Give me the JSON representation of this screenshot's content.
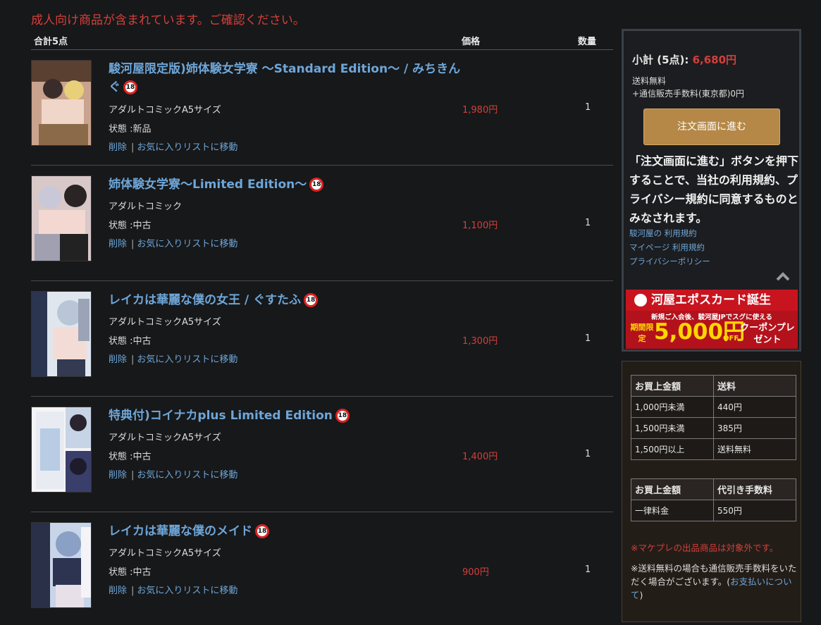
{
  "warning": "成人向け商品が含まれています。ご確認ください。",
  "header": {
    "total": "合計5点",
    "price": "価格",
    "qty": "数量"
  },
  "items": [
    {
      "title": "駿河屋限定版)姉体験女学寮 ～Standard Edition～ / みちきんぐ",
      "category": "アダルトコミックA5サイズ",
      "condition": "状態 :新品",
      "price": "1,980円",
      "qty": "1",
      "delete": "削除",
      "favorite": "お気に入りリストに移動",
      "badge": "18"
    },
    {
      "title": "姉体験女学寮～Limited Edition～",
      "category": "アダルトコミック",
      "condition": "状態 :中古",
      "price": "1,100円",
      "qty": "1",
      "delete": "削除",
      "favorite": "お気に入りリストに移動",
      "badge": "18"
    },
    {
      "title": "レイカは華麗な僕の女王 / ぐすたふ",
      "category": "アダルトコミックA5サイズ",
      "condition": "状態 :中古",
      "price": "1,300円",
      "qty": "1",
      "delete": "削除",
      "favorite": "お気に入りリストに移動",
      "badge": "18"
    },
    {
      "title": "特典付)コイナカplus Limited Edition",
      "category": "アダルトコミックA5サイズ",
      "condition": "状態 :中古",
      "price": "1,400円",
      "qty": "1",
      "delete": "削除",
      "favorite": "お気に入りリストに移動",
      "badge": "18"
    },
    {
      "title": "レイカは華麗な僕のメイド",
      "category": "アダルトコミックA5サイズ",
      "condition": "状態 :中古",
      "price": "900円",
      "qty": "1",
      "delete": "削除",
      "favorite": "お気に入りリストに移動",
      "badge": "18"
    }
  ],
  "summary": {
    "subtotal_label": "小計 (5点):",
    "subtotal_amount": "6,680円",
    "shipping_free": "送料無料",
    "handling_fee": "+通信販売手数料(東京都)0円",
    "order_button": "注文画面に進む",
    "agreement": "「注文画面に進む」ボタンを押下することで、当社の利用規約、プライバシー規約に同意するものとみなされます。",
    "links": [
      "駿河屋の 利用規約",
      "マイページ 利用規約",
      "プライバシーポリシー"
    ]
  },
  "banner": {
    "head": "河屋エポスカード誕生",
    "sub": "新規ご入会後、駿河屋JPでスグに使える",
    "tag": "期間限定",
    "amount": "5,000円",
    "off": "OFF",
    "coupon": "クーポンプレゼント"
  },
  "shipping_table": {
    "headers": [
      "お買上金額",
      "送料"
    ],
    "rows": [
      [
        "1,000円未満",
        "440円"
      ],
      [
        "1,500円未満",
        "385円"
      ],
      [
        "1,500円以上",
        "送料無料"
      ]
    ]
  },
  "cod_table": {
    "headers": [
      "お買上金額",
      "代引き手数料"
    ],
    "rows": [
      [
        "一律料金",
        "550円"
      ]
    ]
  },
  "notes": {
    "marketplace": "※マケプレの出品商品は対象外です。",
    "handling_prefix": "※送料無料の場合も通信販売手数料をいただく場合がございます。(",
    "handling_link": "お支払いについて",
    "handling_suffix": ")"
  },
  "colors": {
    "price": "#d2403b",
    "link": "#6ea6d8",
    "button": "#b58847",
    "background": "#17181a"
  }
}
